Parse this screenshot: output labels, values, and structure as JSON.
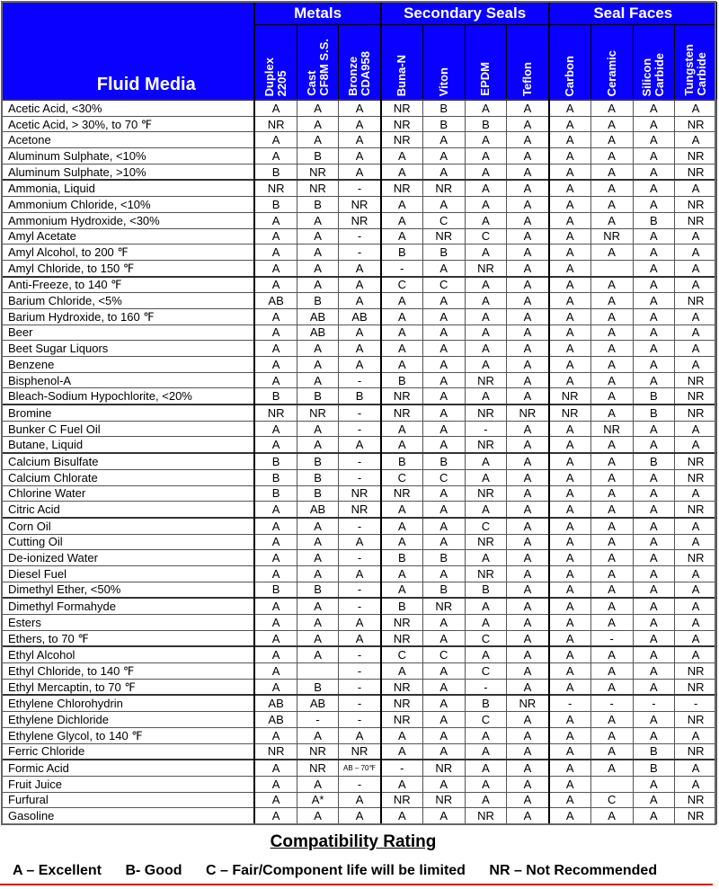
{
  "header": {
    "fluid_label": "Fluid Media",
    "groups": [
      {
        "label": "Metals",
        "span": 3
      },
      {
        "label": "Secondary Seals",
        "span": 4
      },
      {
        "label": "Seal Faces",
        "span": 4
      }
    ],
    "columns": [
      [
        "Duplex",
        "2205"
      ],
      [
        "Cast",
        "CF8M S.S."
      ],
      [
        "Bronze",
        "CDA958"
      ],
      [
        "Buna-N"
      ],
      [
        "Viton"
      ],
      [
        "EPDM"
      ],
      [
        "Teflon"
      ],
      [
        "Carbon"
      ],
      [
        "Ceramic"
      ],
      [
        "Silicon",
        "Carbide"
      ],
      [
        "Tungsten",
        "Carbide"
      ]
    ]
  },
  "colors": {
    "header_bg": "#0a00ff",
    "header_text": "#ffffff",
    "rule": "#e0001b"
  },
  "rows": [
    {
      "fluid": "Acetic Acid, <30%",
      "ratings": [
        "A",
        "A",
        "A",
        "NR",
        "B",
        "A",
        "A",
        "A",
        "A",
        "A",
        "A"
      ]
    },
    {
      "fluid": "Acetic Acid, > 30%, to 70 ℉",
      "ratings": [
        "NR",
        "A",
        "A",
        "NR",
        "B",
        "B",
        "A",
        "A",
        "A",
        "A",
        "NR"
      ]
    },
    {
      "fluid": "Acetone",
      "ratings": [
        "A",
        "A",
        "A",
        "NR",
        "A",
        "A",
        "A",
        "A",
        "A",
        "A",
        "A"
      ]
    },
    {
      "fluid": "Aluminum Sulphate, <10%",
      "ratings": [
        "A",
        "B",
        "A",
        "A",
        "A",
        "A",
        "A",
        "A",
        "A",
        "A",
        "NR"
      ]
    },
    {
      "fluid": "Aluminum Sulphate, >10%",
      "ratings": [
        "B",
        "NR",
        "A",
        "A",
        "A",
        "A",
        "A",
        "A",
        "A",
        "A",
        "NR"
      ]
    },
    {
      "fluid": "Ammonia, Liquid",
      "ratings": [
        "NR",
        "NR",
        "-",
        "NR",
        "NR",
        "A",
        "A",
        "A",
        "A",
        "A",
        "A"
      ]
    },
    {
      "fluid": "Ammonium Chloride, <10%",
      "ratings": [
        "B",
        "B",
        "NR",
        "A",
        "A",
        "A",
        "A",
        "A",
        "A",
        "A",
        "NR"
      ]
    },
    {
      "fluid": "Ammonium Hydroxide, <30%",
      "ratings": [
        "A",
        "A",
        "NR",
        "A",
        "C",
        "A",
        "A",
        "A",
        "A",
        "B",
        "NR"
      ]
    },
    {
      "fluid": "Amyl Acetate",
      "ratings": [
        "A",
        "A",
        "-",
        "A",
        "NR",
        "C",
        "A",
        "A",
        "NR",
        "A",
        "A"
      ]
    },
    {
      "fluid": "Amyl Alcohol, to 200 ℉",
      "ratings": [
        "A",
        "A",
        "-",
        "B",
        "B",
        "A",
        "A",
        "A",
        "A",
        "A",
        "A"
      ]
    },
    {
      "fluid": "Amyl Chloride, to 150 ℉",
      "ratings": [
        "A",
        "A",
        "A",
        "-",
        "A",
        "NR",
        "A",
        "A",
        "",
        "A",
        "A"
      ]
    },
    {
      "fluid": "Anti-Freeze, to 140 ℉",
      "ratings": [
        "A",
        "A",
        "A",
        "C",
        "C",
        "A",
        "A",
        "A",
        "A",
        "A",
        "A"
      ]
    },
    {
      "fluid": "Barium Chloride, <5%",
      "ratings": [
        "AB",
        "B",
        "A",
        "A",
        "A",
        "A",
        "A",
        "A",
        "A",
        "A",
        "NR"
      ]
    },
    {
      "fluid": "Barium Hydroxide, to 160 ℉",
      "ratings": [
        "A",
        "AB",
        "AB",
        "A",
        "A",
        "A",
        "A",
        "A",
        "A",
        "A",
        "A"
      ]
    },
    {
      "fluid": "Beer",
      "ratings": [
        "A",
        "AB",
        "A",
        "A",
        "A",
        "A",
        "A",
        "A",
        "A",
        "A",
        "A"
      ]
    },
    {
      "fluid": "Beet Sugar Liquors",
      "ratings": [
        "A",
        "A",
        "A",
        "A",
        "A",
        "A",
        "A",
        "A",
        "A",
        "A",
        "A"
      ]
    },
    {
      "fluid": "Benzene",
      "ratings": [
        "A",
        "A",
        "A",
        "A",
        "A",
        "A",
        "A",
        "A",
        "A",
        "A",
        "A"
      ]
    },
    {
      "fluid": "Bisphenol-A",
      "ratings": [
        "A",
        "A",
        "-",
        "B",
        "A",
        "NR",
        "A",
        "A",
        "A",
        "A",
        "NR"
      ]
    },
    {
      "fluid": "Bleach-Sodium Hypochlorite, <20%",
      "ratings": [
        "B",
        "B",
        "B",
        "NR",
        "A",
        "A",
        "A",
        "NR",
        "A",
        "B",
        "NR"
      ]
    },
    {
      "fluid": "Bromine",
      "ratings": [
        "NR",
        "NR",
        "-",
        "NR",
        "A",
        "NR",
        "NR",
        "NR",
        "A",
        "B",
        "NR"
      ]
    },
    {
      "fluid": "Bunker C Fuel Oil",
      "ratings": [
        "A",
        "A",
        "-",
        "A",
        "A",
        "-",
        "A",
        "A",
        "NR",
        "A",
        "A"
      ]
    },
    {
      "fluid": "Butane, Liquid",
      "ratings": [
        "A",
        "A",
        "A",
        "A",
        "A",
        "NR",
        "A",
        "A",
        "A",
        "A",
        "A"
      ]
    },
    {
      "fluid": "Calcium Bisulfate",
      "ratings": [
        "B",
        "B",
        "-",
        "B",
        "B",
        "A",
        "A",
        "A",
        "A",
        "B",
        "NR"
      ]
    },
    {
      "fluid": "Calcium Chlorate",
      "ratings": [
        "B",
        "B",
        "-",
        "C",
        "C",
        "A",
        "A",
        "A",
        "A",
        "A",
        "NR"
      ]
    },
    {
      "fluid": "Chlorine Water",
      "ratings": [
        "B",
        "B",
        "NR",
        "NR",
        "A",
        "NR",
        "A",
        "A",
        "A",
        "A",
        "A"
      ]
    },
    {
      "fluid": "Citric Acid",
      "ratings": [
        "A",
        "AB",
        "NR",
        "A",
        "A",
        "A",
        "A",
        "A",
        "A",
        "A",
        "NR"
      ]
    },
    {
      "fluid": "Corn Oil",
      "ratings": [
        "A",
        "A",
        "-",
        "A",
        "A",
        "C",
        "A",
        "A",
        "A",
        "A",
        "A"
      ]
    },
    {
      "fluid": "Cutting Oil",
      "ratings": [
        "A",
        "A",
        "A",
        "A",
        "A",
        "NR",
        "A",
        "A",
        "A",
        "A",
        "A"
      ]
    },
    {
      "fluid": "De-ionized Water",
      "ratings": [
        "A",
        "A",
        "-",
        "B",
        "B",
        "A",
        "A",
        "A",
        "A",
        "A",
        "NR"
      ]
    },
    {
      "fluid": "Diesel Fuel",
      "ratings": [
        "A",
        "A",
        "A",
        "A",
        "A",
        "NR",
        "A",
        "A",
        "A",
        "A",
        "A"
      ]
    },
    {
      "fluid": "Dimethyl Ether, <50%",
      "ratings": [
        "B",
        "B",
        "-",
        "A",
        "B",
        "B",
        "A",
        "A",
        "A",
        "A",
        "A"
      ]
    },
    {
      "fluid": "Dimethyl Formahyde",
      "ratings": [
        "A",
        "A",
        "-",
        "B",
        "NR",
        "A",
        "A",
        "A",
        "A",
        "A",
        "A"
      ]
    },
    {
      "fluid": "Esters",
      "ratings": [
        "A",
        "A",
        "A",
        "NR",
        "A",
        "A",
        "A",
        "A",
        "A",
        "A",
        "A"
      ]
    },
    {
      "fluid": "Ethers, to 70 ℉",
      "ratings": [
        "A",
        "A",
        "A",
        "NR",
        "A",
        "C",
        "A",
        "A",
        "-",
        "A",
        "A"
      ]
    },
    {
      "fluid": "Ethyl Alcohol",
      "ratings": [
        "A",
        "A",
        "-",
        "C",
        "C",
        "A",
        "A",
        "A",
        "A",
        "A",
        "A"
      ]
    },
    {
      "fluid": "Ethyl Chloride, to 140 ℉",
      "ratings": [
        "A",
        "",
        "-",
        "A",
        "A",
        "C",
        "A",
        "A",
        "A",
        "A",
        "NR"
      ]
    },
    {
      "fluid": "Ethyl Mercaptin, to 70 ℉",
      "ratings": [
        "A",
        "B",
        "-",
        "NR",
        "A",
        "-",
        "A",
        "A",
        "A",
        "A",
        "NR"
      ]
    },
    {
      "fluid": "Ethylene Chlorohydrin",
      "ratings": [
        "AB",
        "AB",
        "-",
        "NR",
        "A",
        "B",
        "NR",
        "-",
        "-",
        "-",
        "-"
      ]
    },
    {
      "fluid": "Ethylene Dichloride",
      "ratings": [
        "AB",
        "-",
        "-",
        "NR",
        "A",
        "C",
        "A",
        "A",
        "A",
        "A",
        "NR"
      ]
    },
    {
      "fluid": "Ethylene Glycol, to 140 ℉",
      "ratings": [
        "A",
        "A",
        "A",
        "A",
        "A",
        "A",
        "A",
        "A",
        "A",
        "A",
        "A"
      ]
    },
    {
      "fluid": "Ferric Chloride",
      "ratings": [
        "NR",
        "NR",
        "NR",
        "A",
        "A",
        "A",
        "A",
        "A",
        "A",
        "B",
        "NR"
      ]
    },
    {
      "fluid": "Formic Acid",
      "ratings": [
        "A",
        "NR",
        "AB – 70℉",
        "-",
        "NR",
        "A",
        "A",
        "A",
        "A",
        "B",
        "A"
      ]
    },
    {
      "fluid": "Fruit Juice",
      "ratings": [
        "A",
        "A",
        "-",
        "A",
        "A",
        "A",
        "A",
        "A",
        "",
        "A",
        "A"
      ]
    },
    {
      "fluid": "Furfural",
      "ratings": [
        "A",
        "A*",
        "A",
        "NR",
        "NR",
        "A",
        "A",
        "A",
        "C",
        "A",
        "NR"
      ]
    },
    {
      "fluid": "Gasoline",
      "ratings": [
        "A",
        "A",
        "A",
        "A",
        "A",
        "NR",
        "A",
        "A",
        "A",
        "A",
        "NR"
      ]
    }
  ],
  "legend": {
    "title": "Compatibility Rating",
    "items": [
      "A – Excellent",
      "B- Good",
      "C – Fair/Component life will be limited",
      "NR – Not Recommended"
    ]
  }
}
